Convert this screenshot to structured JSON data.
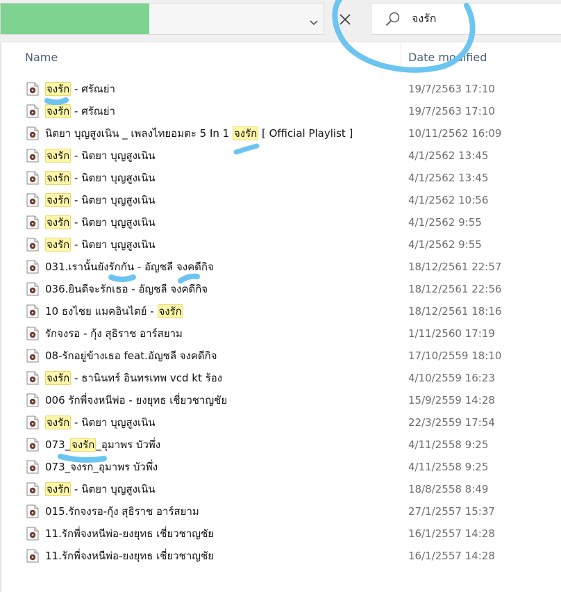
{
  "address": {
    "progress": 0.46
  },
  "search": {
    "value": "จงรัก",
    "query": "จงรัก"
  },
  "columns": {
    "name": "Name",
    "date": "Date modified"
  },
  "files": [
    {
      "name": "จงรัก - ศรัณย่า",
      "date": "19/7/2563 17:10"
    },
    {
      "name": "จงรัก - ศรัณย่า",
      "date": "19/7/2563 17:10"
    },
    {
      "name": "นิตยา บุญสูงเนิน _ เพลงไทยอมตะ 5 In 1 จงรัก [ Official Playlist ]",
      "date": "10/11/2562 16:09"
    },
    {
      "name": "จงรัก - นิตยา บุญสูงเนิน",
      "date": "4/1/2562 13:45"
    },
    {
      "name": "จงรัก - นิตยา บุญสูงเนิน",
      "date": "4/1/2562 13:45"
    },
    {
      "name": "จงรัก - นิตยา บุญสูงเนิน",
      "date": "4/1/2562 10:56"
    },
    {
      "name": "จงรัก - นิตยา บุญสูงเนิน",
      "date": "4/1/2562 9:55"
    },
    {
      "name": "จงรัก - นิตยา บุญสูงเนิน",
      "date": "4/1/2562 9:55"
    },
    {
      "name": "031.เรานั้นยังรักกัน - อัญชลี จงคดีกิจ",
      "date": "18/12/2561 22:57"
    },
    {
      "name": "036.ยินดีจะรักเธอ - อัญชลี จงคดีกิจ",
      "date": "18/12/2561 22:56"
    },
    {
      "name": "10 ธงไชย แมคอินไตย์ - จงรัก",
      "date": "18/12/2561 18:16"
    },
    {
      "name": "รักจงรอ - กุ้ง สุธิราช อาร์สยาม",
      "date": "1/11/2560 17:19"
    },
    {
      "name": "08-รักอยู่ข้างเธอ feat.อัญชลี จงคดีกิจ",
      "date": "17/10/2559 18:10"
    },
    {
      "name": "จงรัก - ธานินทร์ อินทรเทพ vcd kt ร้อง",
      "date": "4/10/2559 16:23"
    },
    {
      "name": "006 รักพี่จงหนีพ่อ - ยงยุทธ เชี่ยวชาญชัย",
      "date": "15/9/2559 14:28"
    },
    {
      "name": "จงรัก - นิตยา บุญสูงเนิน",
      "date": "22/3/2559 17:54"
    },
    {
      "name": "073_จงรัก_อุมาพร บัวพึ่ง",
      "date": "4/11/2558 9:25"
    },
    {
      "name": "073_จงรก_อุมาพร บัวพึ่ง",
      "date": "4/11/2558 9:25"
    },
    {
      "name": "จงรัก - นิตยา บุญสูงเนิน",
      "date": "18/8/2558 8:49"
    },
    {
      "name": "015.รักจงรอ-กุ้ง สุธิราช อาร์สยาม",
      "date": "27/1/2557 15:37"
    },
    {
      "name": "11.รักพี่จงหนีพ่อ-ยงยุทธ เชี่ยวชาญชัย",
      "date": "16/1/2557 14:28"
    },
    {
      "name": "11.รักพี่จงหนีพ่อ-ยงยุทธ เชี่ยวชาญชัย",
      "date": "16/1/2557 14:28"
    }
  ],
  "colors": {
    "progress": "#7fd391",
    "highlight": "#fdf6a8",
    "annotation": "#6cc5f0",
    "header_text": "#4c607a"
  }
}
